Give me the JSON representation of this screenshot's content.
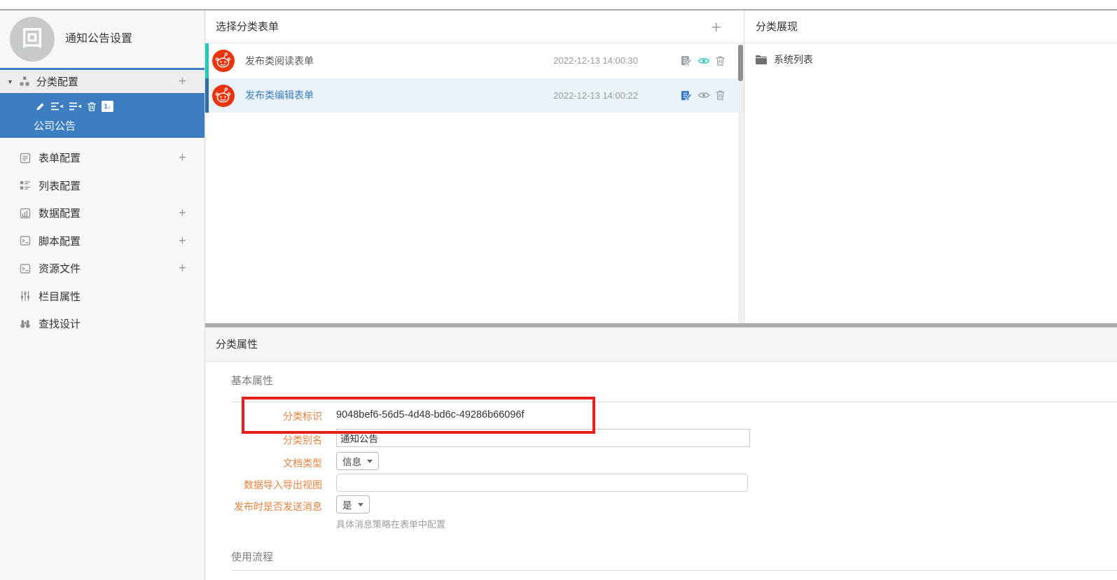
{
  "app": {
    "title": "通知公告设置",
    "logo_glyph": "回"
  },
  "icons": {
    "plus": "+",
    "caret_down": "▼",
    "select_chevron": "v"
  },
  "colors": {
    "accent_blue": "#3d7ec1",
    "selected_row_bg": "#ebf3fa",
    "teal_bar": "#24c6b8",
    "blue_bar": "#2d6ca8",
    "link_blue": "#3b7ec0",
    "avatar_red": "#e8350e",
    "annotation_red": "#e52018",
    "label_orange": "#e4833f",
    "divider_gray": "#ababab"
  },
  "sidebar": {
    "group": {
      "label": "分类配置"
    },
    "selected_item": {
      "label": "公司公告",
      "sort_badge": "1↓"
    },
    "items": [
      {
        "label": "表单配置",
        "icon": "form-icon",
        "has_add": true
      },
      {
        "label": "列表配置",
        "icon": "list-icon",
        "has_add": false
      },
      {
        "label": "数据配置",
        "icon": "chart-icon",
        "has_add": true
      },
      {
        "label": "脚本配置",
        "icon": "terminal-icon",
        "has_add": true
      },
      {
        "label": "资源文件",
        "icon": "terminal-icon",
        "has_add": true
      },
      {
        "label": "栏目属性",
        "icon": "sliders-icon",
        "has_add": false
      },
      {
        "label": "查找设计",
        "icon": "binoculars-icon",
        "has_add": false
      }
    ]
  },
  "form_list_panel": {
    "title": "选择分类表单",
    "rows": [
      {
        "name": "发布类阅读表单",
        "timestamp": "2022-12-13 14:00:30",
        "selected": false
      },
      {
        "name": "发布类编辑表单",
        "timestamp": "2022-12-13 14:00:22",
        "selected": true
      }
    ]
  },
  "display_panel": {
    "title": "分类展现",
    "items": [
      {
        "label": "系统列表"
      }
    ]
  },
  "properties_panel": {
    "title": "分类属性",
    "sections": {
      "basic": "基本属性",
      "flow": "使用流程"
    },
    "fields": {
      "category_id": {
        "label": "分类标识",
        "value": "9048bef6-56d5-4d48-bd6c-49286b66096f"
      },
      "category_alias": {
        "label": "分类别名",
        "value": "通知公告"
      },
      "doc_type": {
        "label": "文档类型",
        "value": "信息"
      },
      "import_export_view": {
        "label": "数据导入导出视图",
        "value": ""
      },
      "send_message": {
        "label": "发布时是否发送消息",
        "value": "是",
        "hint": "具体消息策略在表单中配置"
      }
    }
  }
}
